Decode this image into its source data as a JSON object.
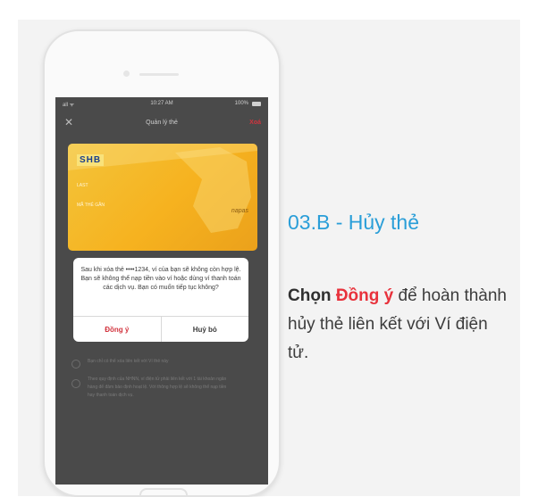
{
  "phone": {
    "status": {
      "signal": "all ᯤ",
      "time": "10:27 AM",
      "battery": "100%"
    },
    "nav": {
      "close": "✕",
      "title": "Quản lý thẻ",
      "delete": "Xoá"
    },
    "card": {
      "bank_logo": "SHB",
      "line1": "LAST",
      "line2": "MÃ THẺ GẮN",
      "network": "napas"
    },
    "dialog": {
      "message": "Sau khi xóa thẻ ••••1234, ví của bạn sẽ không còn hợp lệ. Bạn sẽ không thể nạp tiền vào ví hoặc dùng ví thanh toán các dịch vụ. Bạn có muốn tiếp tục không?",
      "agree": "Đồng ý",
      "cancel": "Huỷ bỏ"
    },
    "notes": [
      "Bạn chỉ có thể xóa liên kết với Ví thẻ này",
      "Theo quy định của NHNN, ví điện tử phải liên kết với 1 tài khoản ngân hàng để đảm bảo định hoạt lệ. Với thông hợp lệ sẽ không thể nạp tiền hay thanh toán dịch vụ."
    ],
    "accent_red": "#d2343e"
  },
  "content": {
    "heading": "03.B - Hủy thẻ",
    "desc_prefix": "Chọn ",
    "desc_highlight": "Đồng ý",
    "desc_suffix": " để hoàn thành hủy thẻ liên kết với Ví điện tử.",
    "heading_color": "#2a9ed8",
    "highlight_color": "#e8323c"
  }
}
